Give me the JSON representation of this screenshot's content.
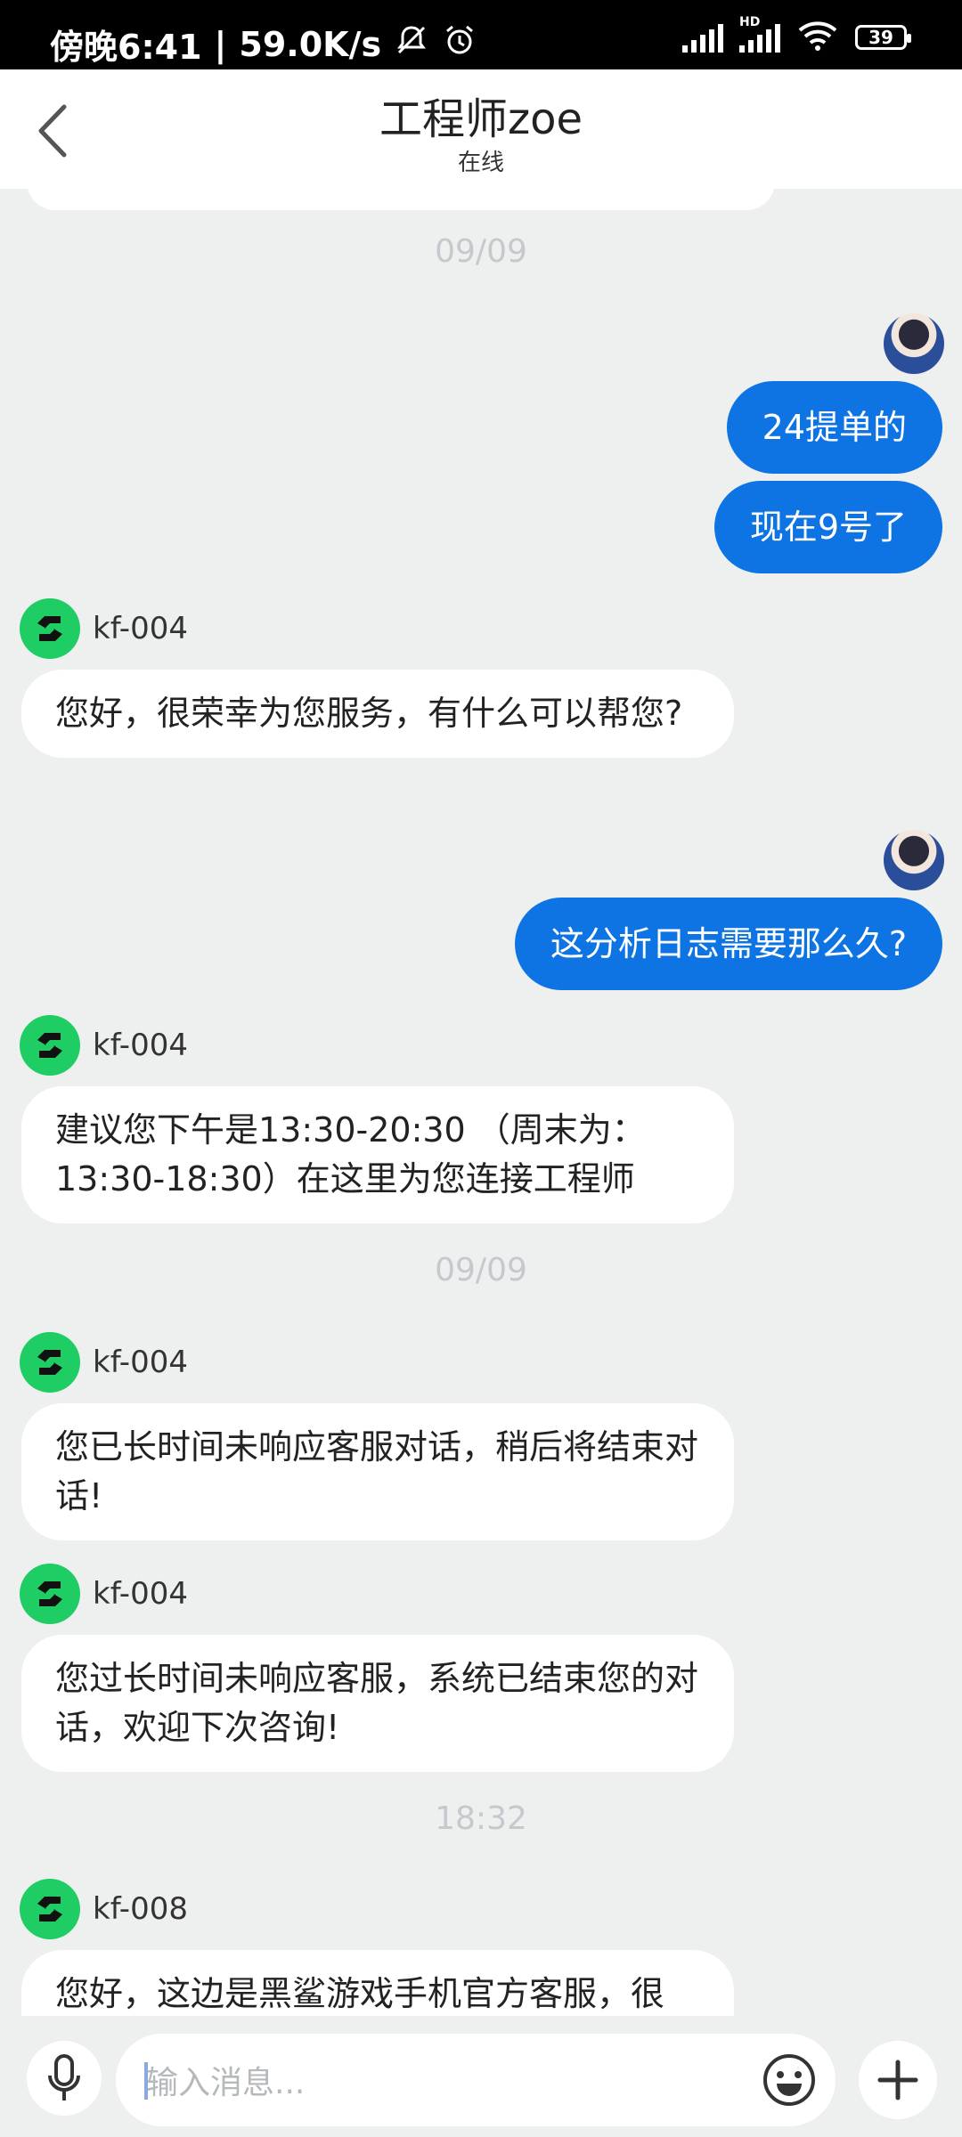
{
  "status_bar": {
    "time": "傍晚6:41",
    "separator": "|",
    "speed": "59.0K/s",
    "battery": "39",
    "hd_label": "HD"
  },
  "header": {
    "title": "工程师zoe",
    "subtitle": "在线"
  },
  "chat": {
    "timestamps": [
      "09/09",
      "09/09",
      "18:32"
    ],
    "outgoing": [
      "24提单的",
      "现在9号了",
      "这分析日志需要那么久?"
    ],
    "agents": [
      "kf-004",
      "kf-004",
      "kf-004",
      "kf-004",
      "kf-008"
    ],
    "incoming": [
      "您好，很荣幸为您服务，有什么可以帮您?",
      "建议您下午是13:30-20:30 （周末为：13:30-18:30）在这里为您连接工程师",
      "您已长时间未响应客服对话，稍后将结束对话!",
      "您过长时间未响应客服，系统已结束您的对话，欢迎下次咨询!",
      "您好，这边是黑鲨游戏手机官方客服，很"
    ]
  },
  "input": {
    "placeholder": "输入消息..."
  },
  "icons": {
    "back": "chevron-left-icon",
    "mic": "microphone-icon",
    "emoji": "emoji-icon",
    "plus": "plus-icon",
    "agent_logo": "black-shark-logo-icon"
  },
  "colors": {
    "outgoing_bubble": "#0f74e3",
    "agent_logo": "#1ecd63",
    "background": "#eef0f0"
  }
}
